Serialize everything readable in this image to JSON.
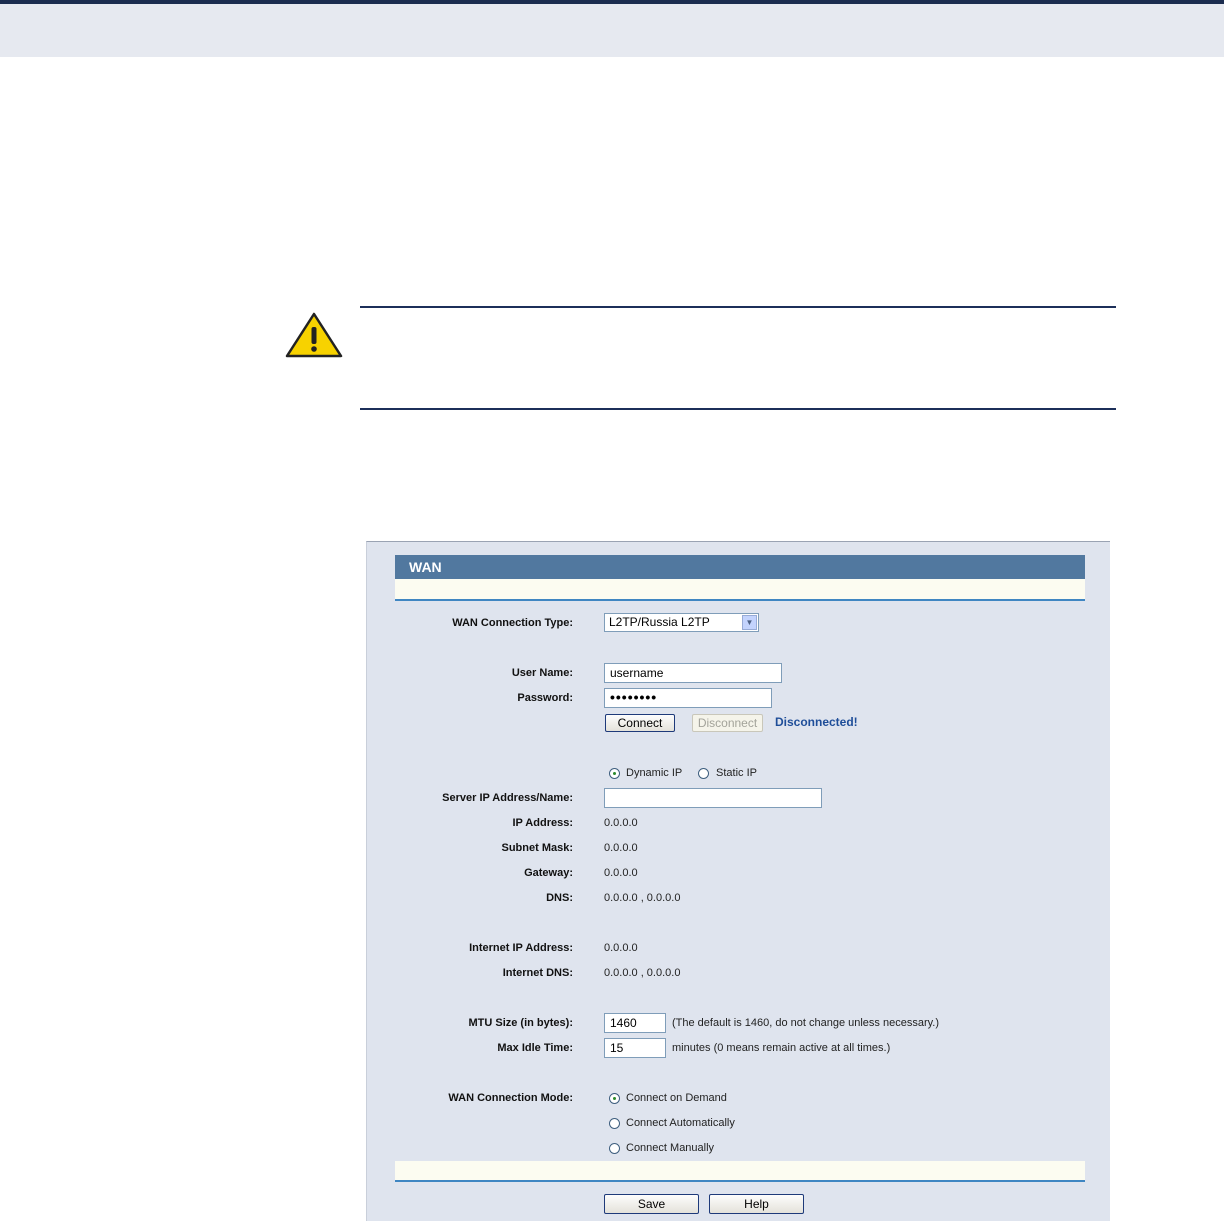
{
  "wan": {
    "title": "WAN",
    "connection_type": {
      "label": "WAN Connection Type:",
      "value": "L2TP/Russia L2TP"
    },
    "user_name": {
      "label": "User Name:",
      "value": "username"
    },
    "password": {
      "label": "Password:",
      "value": "••••••••"
    },
    "connect_label": "Connect",
    "disconnect_label": "Disconnect",
    "status": "Disconnected!",
    "ip_mode": {
      "dynamic_label": "Dynamic IP",
      "static_label": "Static IP",
      "selected": "Dynamic IP"
    },
    "server": {
      "label": "Server IP Address/Name:",
      "value": ""
    },
    "ip_address": {
      "label": "IP Address:",
      "value": "0.0.0.0"
    },
    "subnet_mask": {
      "label": "Subnet Mask:",
      "value": "0.0.0.0"
    },
    "gateway": {
      "label": "Gateway:",
      "value": "0.0.0.0"
    },
    "dns": {
      "label": "DNS:",
      "value": "0.0.0.0 , 0.0.0.0"
    },
    "internet_ip": {
      "label": "Internet IP Address:",
      "value": "0.0.0.0"
    },
    "internet_dns": {
      "label": "Internet DNS:",
      "value": "0.0.0.0 , 0.0.0.0"
    },
    "mtu": {
      "label": "MTU Size (in bytes):",
      "value": "1460",
      "hint": "(The default is 1460, do not change unless necessary.)"
    },
    "idle": {
      "label": "Max Idle Time:",
      "value": "15",
      "hint": "minutes (0 means remain active at all times.)"
    },
    "mode": {
      "label": "WAN Connection Mode:",
      "options": [
        "Connect on Demand",
        "Connect Automatically",
        "Connect Manually"
      ],
      "selected": "Connect on Demand"
    },
    "save_label": "Save",
    "help_label": "Help"
  }
}
